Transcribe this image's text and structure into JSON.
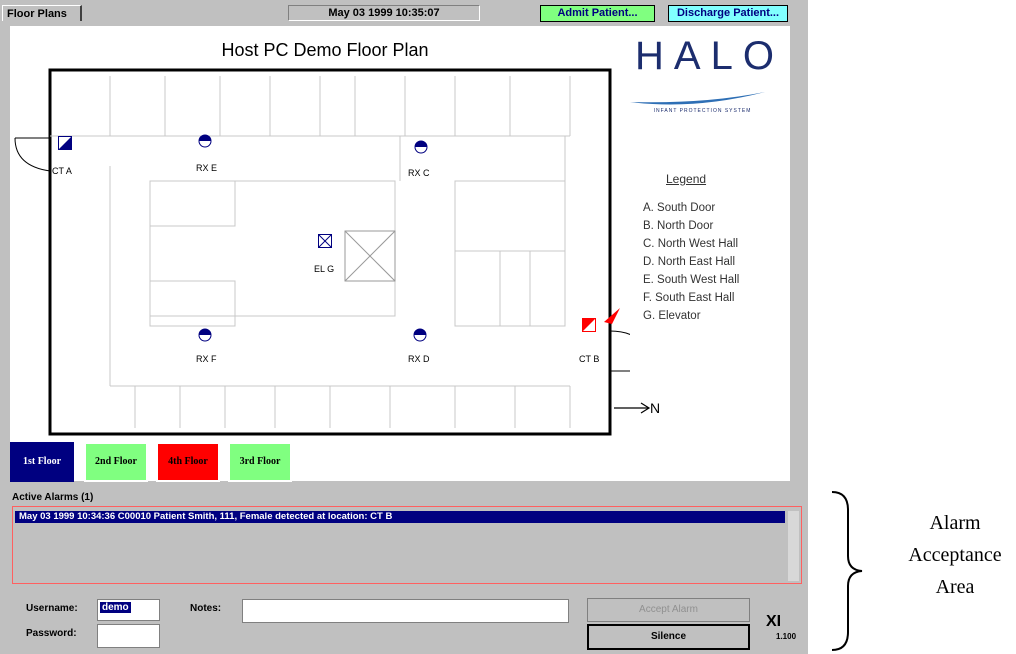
{
  "topbar": {
    "tab_label": "Floor Plans",
    "clock": "May 03 1999  10:35:07",
    "admit_label": "Admit Patient...",
    "discharge_label": "Discharge Patient..."
  },
  "floor_plan": {
    "title": "Host PC Demo Floor Plan",
    "logo": "HALO",
    "logo_subtitle": "INFANT PROTECTION SYSTEM",
    "rooms": [
      "CT A",
      "RX E",
      "RX C",
      "EL G",
      "RX F",
      "RX D",
      "CT B"
    ],
    "legend_title": "Legend",
    "legend_items": [
      "A. South Door",
      "B. North Door",
      "C. North West Hall",
      "D. North East Hall",
      "E. South West Hall",
      "F. South East Hall",
      "G. Elevator"
    ],
    "north_label": "N",
    "alarm_color": "#ff0000",
    "door_color": "#000080"
  },
  "floors": [
    {
      "label": "1st Floor",
      "bg": "#000080",
      "fg": "#ffffff"
    },
    {
      "label": "2nd Floor",
      "bg": "#80ff80",
      "fg": "#000000"
    },
    {
      "label": "4th Floor",
      "bg": "#ff0000",
      "fg": "#000000"
    },
    {
      "label": "3rd Floor",
      "bg": "#80ff80",
      "fg": "#000000"
    }
  ],
  "alarms": {
    "header": "Active Alarms (1)",
    "rows": [
      "May 03 1999  10:34:36     C00010 Patient Smith, 111, Female detected at location: CT B"
    ]
  },
  "login": {
    "username_label": "Username:",
    "username_value": "demo",
    "password_label": "Password:",
    "notes_label": "Notes:",
    "accept_label": "Accept Alarm",
    "silence_label": "Silence",
    "brand": "XI",
    "brand_version": "1.100"
  },
  "annotation": {
    "lines": [
      "Alarm",
      "Acceptance",
      "Area"
    ]
  }
}
